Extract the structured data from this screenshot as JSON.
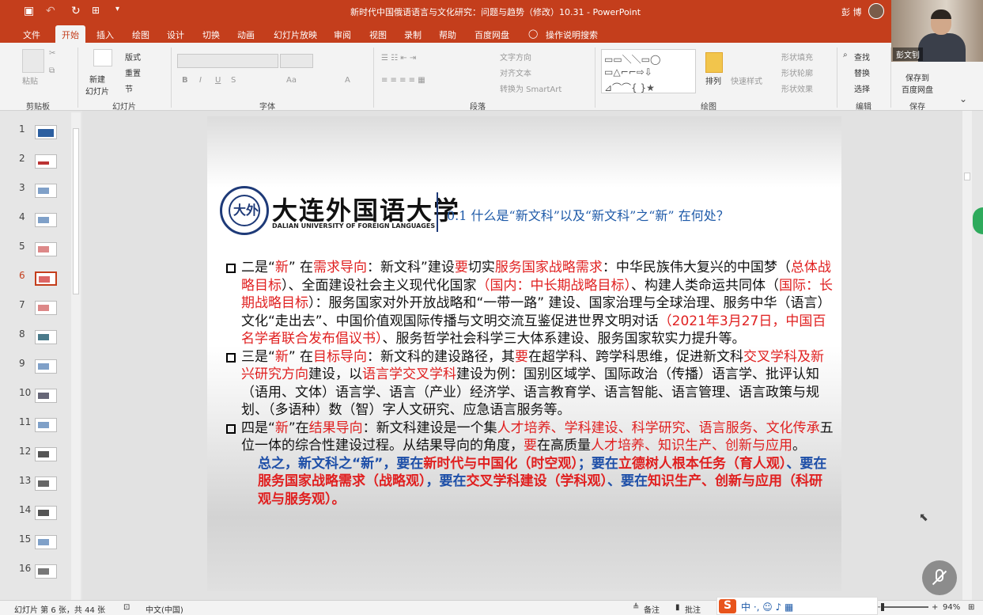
{
  "window": {
    "doc_title": "新时代中国俄语语言与文化研究：问题与趋势（修改）10.31 - PowerPoint",
    "user_name": "彭 博",
    "camera_label": "彭文钊"
  },
  "tabs": [
    "文件",
    "开始",
    "插入",
    "绘图",
    "设计",
    "切换",
    "动画",
    "幻灯片放映",
    "审阅",
    "视图",
    "录制",
    "帮助",
    "百度网盘",
    "操作说明搜索"
  ],
  "active_tab": "开始",
  "ribbon": {
    "clipboard": {
      "paste": "粘贴",
      "group": "剪贴板"
    },
    "slides": {
      "new_slide": "新建\n幻灯片",
      "layout": "版式",
      "reset": "重置",
      "section": "节",
      "group": "幻灯片"
    },
    "font": {
      "group": "字体",
      "bold": "B",
      "italic": "I",
      "underline": "U",
      "strike": "S",
      "case": "Aa",
      "color": "A"
    },
    "paragraph": {
      "text_direction": "文字方向",
      "align_text": "对齐文本",
      "smartart": "转换为 SmartArt",
      "group": "段落"
    },
    "drawing": {
      "arrange": "排列",
      "quick_styles": "快速样式",
      "fill": "形状填充",
      "outline": "形状轮廓",
      "effects": "形状效果",
      "group": "绘图"
    },
    "editing": {
      "find": "查找",
      "replace": "替换",
      "select": "选择",
      "group": "编辑"
    },
    "save": {
      "save_baidu": "保存到\n百度网盘",
      "group": "保存"
    }
  },
  "thumbnails": [
    "1",
    "2",
    "3",
    "4",
    "5",
    "6",
    "7",
    "8",
    "9",
    "10",
    "11",
    "12",
    "13",
    "14",
    "15",
    "16"
  ],
  "selected_slide": 6,
  "slide": {
    "university_cn": "大连外国语大学",
    "university_en": "DALIAN UNIVERSITY OF FOREIGN LANGUAGES",
    "section_title": "0.1  什么是“新文科”以及“新文科”之“新”  在何处？",
    "p1": [
      {
        "t": "二是“",
        "c": "k"
      },
      {
        "t": "新",
        "c": "r"
      },
      {
        "t": "” 在",
        "c": "k"
      },
      {
        "t": "需求导向",
        "c": "r"
      },
      {
        "t": "：新文科”建设",
        "c": "k"
      },
      {
        "t": "要",
        "c": "r"
      },
      {
        "t": "切实",
        "c": "k"
      },
      {
        "t": "服务国家战略需求",
        "c": "r"
      },
      {
        "t": "：中华民族伟大复兴的中国梦（",
        "c": "k"
      },
      {
        "t": "总体战略目标",
        "c": "r"
      },
      {
        "t": "）、全面建设社会主义现代化国家",
        "c": "k"
      },
      {
        "t": "（国内：中长期战略目标）",
        "c": "r"
      },
      {
        "t": "、构建人类命运共同体（",
        "c": "k"
      },
      {
        "t": "国际：长期战略目标",
        "c": "r"
      },
      {
        "t": "）：服务国家对外开放战略和“一带一路” 建设、国家治理与全球治理、服务中华（语言）文化“走出去”、中国价值观国际传播与文明交流互鉴促进世界文明对话",
        "c": "k"
      },
      {
        "t": "（2021年3月27日，中国百名学者联合发布倡议书）",
        "c": "r"
      },
      {
        "t": "、服务哲学社会科学三大体系建设、服务国家软实力提升等。",
        "c": "k"
      }
    ],
    "p2": [
      {
        "t": "三是“",
        "c": "k"
      },
      {
        "t": "新",
        "c": "r"
      },
      {
        "t": "” 在",
        "c": "k"
      },
      {
        "t": "目标导向",
        "c": "r"
      },
      {
        "t": "：新文科的建设路径，其",
        "c": "k"
      },
      {
        "t": "要",
        "c": "r"
      },
      {
        "t": "在超学科、跨学科思维，促进新文科",
        "c": "k"
      },
      {
        "t": "交叉学科及新兴研究方向",
        "c": "r"
      },
      {
        "t": "建设，以",
        "c": "k"
      },
      {
        "t": "语言学交叉学科",
        "c": "r"
      },
      {
        "t": "建设为例：国别区域学、国际政治（传播）语言学、批评认知（语用、文体）语言学、语言（产业）经济学、语言教育学、语言智能、语言管理、语言政策与规划、（多语种）数（智）字人文研究、应急语言服务等。",
        "c": "k"
      }
    ],
    "p3": [
      {
        "t": "四是“",
        "c": "k"
      },
      {
        "t": "新",
        "c": "r"
      },
      {
        "t": "”在",
        "c": "k"
      },
      {
        "t": "结果导向",
        "c": "r"
      },
      {
        "t": "：新文科建设是一个集",
        "c": "k"
      },
      {
        "t": "人才培养、学科建设、科学研究、语言服务、文化传承",
        "c": "r"
      },
      {
        "t": "五位一体的综合性建设过程。从结果导向的角度，",
        "c": "k"
      },
      {
        "t": "要",
        "c": "r"
      },
      {
        "t": "在高质量",
        "c": "k"
      },
      {
        "t": "人才培养、知识生产、创新与应用",
        "c": "r"
      },
      {
        "t": "。",
        "c": "k"
      }
    ],
    "summary": [
      {
        "t": "总之，新文科之“新”，要在",
        "c": "b"
      },
      {
        "t": "新时代与中国化（时空观）",
        "c": "r"
      },
      {
        "t": "；要在",
        "c": "b"
      },
      {
        "t": "立德树人根本任务（育人观）",
        "c": "r"
      },
      {
        "t": "、要在",
        "c": "b"
      },
      {
        "t": "服务国家战略需求（战略观）",
        "c": "r"
      },
      {
        "t": "，要在",
        "c": "b"
      },
      {
        "t": "交叉学科建设（学科观）",
        "c": "r"
      },
      {
        "t": "、要在",
        "c": "b"
      },
      {
        "t": "知识生产、创新与应用（科研观与服务观）",
        "c": "r"
      },
      {
        "t": "。",
        "c": "r"
      }
    ]
  },
  "status": {
    "slide_info": "幻灯片 第 6 张，共 44 张",
    "language": "中文(中国)",
    "notes": "备注",
    "comments": "批注",
    "ime": "中 ·, ☺ ♪ ▦",
    "zoom": "94%"
  },
  "colors": {
    "accent": "#c43e1c",
    "red_text": "#e02020",
    "blue_text": "#1e4fa8"
  }
}
